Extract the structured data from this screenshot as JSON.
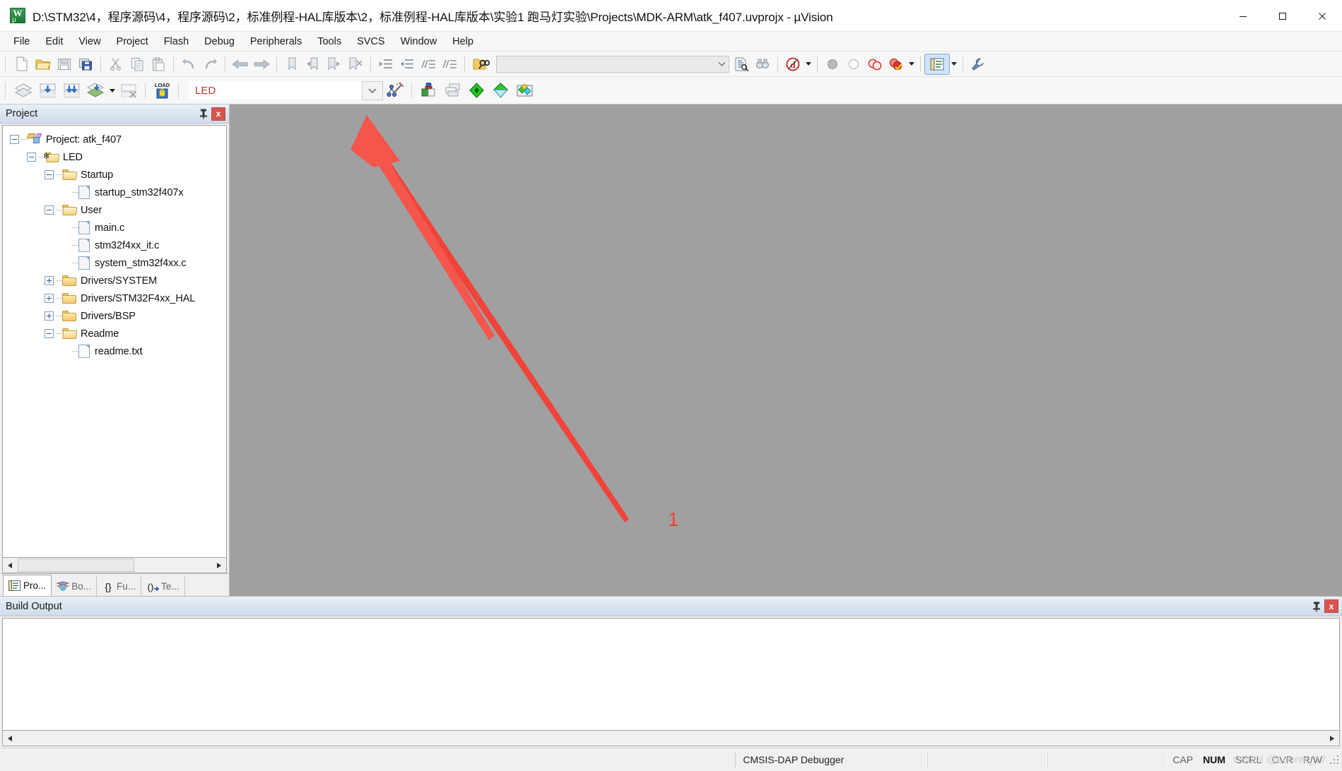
{
  "window": {
    "title": "D:\\STM32\\4，程序源码\\4，程序源码\\2，标准例程-HAL库版本\\2，标准例程-HAL库版本\\实验1 跑马灯实验\\Projects\\MDK-ARM\\atk_f407.uvprojx - µVision",
    "app_icon": "uvision-logo-icon",
    "controls": {
      "minimize": "minimize-icon",
      "maximize": "maximize-icon",
      "close": "close-icon"
    }
  },
  "menubar": {
    "items": [
      {
        "label": "File"
      },
      {
        "label": "Edit"
      },
      {
        "label": "View"
      },
      {
        "label": "Project"
      },
      {
        "label": "Flash"
      },
      {
        "label": "Debug"
      },
      {
        "label": "Peripherals"
      },
      {
        "label": "Tools"
      },
      {
        "label": "SVCS"
      },
      {
        "label": "Window"
      },
      {
        "label": "Help"
      }
    ]
  },
  "toolbar_file": {
    "buttons": [
      {
        "name": "new-file-button",
        "icon": "new-document-icon"
      },
      {
        "name": "open-file-button",
        "icon": "open-folder-icon"
      },
      {
        "name": "save-button",
        "icon": "save-disk-icon"
      },
      {
        "name": "save-all-button",
        "icon": "save-all-icon"
      },
      {
        "name": "cut-button",
        "icon": "scissors-icon"
      },
      {
        "name": "copy-button",
        "icon": "copy-icon"
      },
      {
        "name": "paste-button",
        "icon": "paste-icon"
      },
      {
        "name": "undo-button",
        "icon": "undo-arrow-icon"
      },
      {
        "name": "redo-button",
        "icon": "redo-arrow-icon"
      },
      {
        "name": "navigate-back-button",
        "icon": "arrow-left-icon"
      },
      {
        "name": "navigate-forward-button",
        "icon": "arrow-right-icon"
      },
      {
        "name": "bookmark-toggle-button",
        "icon": "bookmark-icon"
      },
      {
        "name": "bookmark-prev-button",
        "icon": "bookmark-prev-icon"
      },
      {
        "name": "bookmark-next-button",
        "icon": "bookmark-next-icon"
      },
      {
        "name": "bookmark-clear-button",
        "icon": "bookmark-clear-icon"
      },
      {
        "name": "indent-button",
        "icon": "indent-right-icon"
      },
      {
        "name": "outdent-button",
        "icon": "indent-left-icon"
      },
      {
        "name": "comment-button",
        "icon": "comment-lines-icon"
      },
      {
        "name": "uncomment-button",
        "icon": "uncomment-lines-icon"
      },
      {
        "name": "find-in-files-button",
        "icon": "find-in-files-icon"
      }
    ],
    "search": {
      "value": "",
      "placeholder": "",
      "dropdown_icon": "chevron-down-icon"
    },
    "after_search": [
      {
        "name": "incremental-find-button",
        "icon": "find-document-icon"
      },
      {
        "name": "find-button",
        "icon": "binoculars-icon"
      },
      {
        "name": "debug-session-button",
        "icon": "debug-d-icon"
      }
    ],
    "breakpoints": [
      {
        "name": "insert-breakpoint-button",
        "icon": "breakpoint-gray-icon"
      },
      {
        "name": "kill-breakpoint-button",
        "icon": "breakpoint-hollow-icon"
      },
      {
        "name": "disable-breakpoint-button",
        "icon": "breakpoint-disable-icon"
      },
      {
        "name": "kill-all-breakpoints-button",
        "icon": "breakpoint-kill-all-icon"
      }
    ],
    "right": [
      {
        "name": "project-window-toggle-button",
        "icon": "project-window-icon",
        "active": true
      },
      {
        "name": "configure-toolbars-button",
        "icon": "wrench-icon"
      }
    ]
  },
  "toolbar_build": {
    "buttons": [
      {
        "name": "translate-file-button",
        "icon": "translate-layers-icon"
      },
      {
        "name": "build-target-button",
        "icon": "build-down-icon"
      },
      {
        "name": "rebuild-all-button",
        "icon": "rebuild-all-icon"
      },
      {
        "name": "batch-build-button",
        "icon": "batch-build-icon"
      },
      {
        "name": "stop-build-button",
        "icon": "stop-build-icon"
      },
      {
        "name": "download-button",
        "icon": "load-flash-icon"
      }
    ],
    "target_select": {
      "value": "LED",
      "dropdown_icon": "chevron-down-icon"
    },
    "right_buttons": [
      {
        "name": "configure-target-options-button",
        "icon": "magic-wand-target-icon"
      },
      {
        "name": "manage-project-items-button",
        "icon": "manage-components-icon"
      },
      {
        "name": "manage-multi-project-button",
        "icon": "multi-project-icon"
      },
      {
        "name": "pack-installer-button",
        "icon": "green-diamond-icon"
      },
      {
        "name": "manage-run-time-button",
        "icon": "green-diamond-filter-icon"
      },
      {
        "name": "select-software-packs-button",
        "icon": "software-packs-icon"
      }
    ]
  },
  "project_panel": {
    "title": "Project",
    "pin_icon": "pin-icon",
    "close_label": "x",
    "tree": [
      {
        "label": "Project: atk_f407",
        "depth": 0,
        "type": "project",
        "state": "expanded"
      },
      {
        "label": "LED",
        "depth": 1,
        "type": "target",
        "state": "expanded"
      },
      {
        "label": "Startup",
        "depth": 2,
        "type": "group",
        "state": "expanded"
      },
      {
        "label": "startup_stm32f407x",
        "depth": 3,
        "type": "file-asm"
      },
      {
        "label": "User",
        "depth": 2,
        "type": "group",
        "state": "expanded"
      },
      {
        "label": "main.c",
        "depth": 3,
        "type": "file-c"
      },
      {
        "label": "stm32f4xx_it.c",
        "depth": 3,
        "type": "file-c"
      },
      {
        "label": "system_stm32f4xx.c",
        "depth": 3,
        "type": "file-c"
      },
      {
        "label": "Drivers/SYSTEM",
        "depth": 2,
        "type": "group",
        "state": "collapsed"
      },
      {
        "label": "Drivers/STM32F4xx_HAL",
        "depth": 2,
        "type": "group",
        "state": "collapsed"
      },
      {
        "label": "Drivers/BSP",
        "depth": 2,
        "type": "group",
        "state": "collapsed"
      },
      {
        "label": "Readme",
        "depth": 2,
        "type": "group",
        "state": "expanded"
      },
      {
        "label": "readme.txt",
        "depth": 3,
        "type": "file-txt"
      }
    ],
    "tabs": [
      {
        "label": "Pro...",
        "icon": "project-tab-icon",
        "selected": true
      },
      {
        "label": "Bo...",
        "icon": "books-tab-icon",
        "selected": false
      },
      {
        "label": "Fu...",
        "icon": "functions-braces-icon",
        "selected": false
      },
      {
        "label": "Te...",
        "icon": "templates-icon",
        "selected": false
      }
    ],
    "scrollbar": {
      "left_arrow_icon": "triangle-left-icon",
      "right_arrow_icon": "triangle-right-icon"
    }
  },
  "build_output": {
    "title": "Build Output",
    "pin_icon": "pin-icon",
    "close_label": "x",
    "content": "",
    "scrollbar": {
      "left_arrow_icon": "triangle-left-icon",
      "right_arrow_icon": "triangle-right-icon"
    }
  },
  "statusbar": {
    "message": "",
    "debugger": "CMSIS-DAP Debugger",
    "cell2": "",
    "cell3": "",
    "indicators": [
      {
        "label": "CAP",
        "active": false
      },
      {
        "label": "NUM",
        "active": true
      },
      {
        "label": "SCRL",
        "active": false
      },
      {
        "label": "OVR",
        "active": false
      },
      {
        "label": "R/W",
        "active": false
      }
    ],
    "watermark": "CSDN @Lonnie_17"
  },
  "annotation": {
    "number_label": "1",
    "color": "#f0433a",
    "points_to": "configure-target-options-button"
  }
}
